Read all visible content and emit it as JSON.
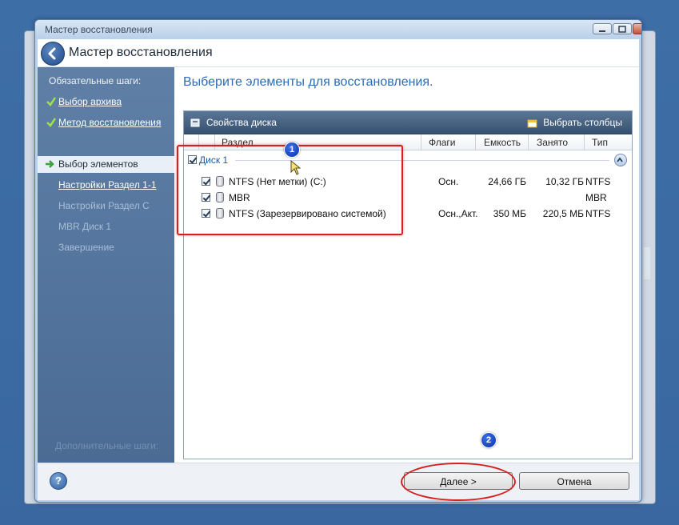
{
  "window": {
    "title": "Мастер восстановления",
    "header_title": "Мастер восстановления"
  },
  "sidebar": {
    "header": "Обязательные шаги:",
    "items": [
      {
        "label": "Выбор архива",
        "state": "done"
      },
      {
        "label": "Метод восстановления",
        "state": "done"
      },
      {
        "label": "Выбор элементов",
        "state": "current"
      },
      {
        "label": "Настройки Раздел 1-1",
        "state": "link"
      },
      {
        "label": "Настройки Раздел C",
        "state": "dim"
      },
      {
        "label": "MBR Диск 1",
        "state": "dim"
      },
      {
        "label": "Завершение",
        "state": "dim"
      }
    ],
    "footer": "Дополнительные шаги:"
  },
  "main": {
    "heading": "Выберите элементы для восстановления.",
    "toolbar": {
      "disk_props": "Свойства диска",
      "choose_columns": "Выбрать столбцы"
    },
    "columns": {
      "partition": "Раздел",
      "flags": "Флаги",
      "capacity": "Емкость",
      "used": "Занято",
      "type": "Тип"
    },
    "group": {
      "label": "Диск 1"
    },
    "rows": [
      {
        "name": "NTFS (Нет метки) (C:)",
        "flags": "Осн.",
        "capacity": "24,66 ГБ",
        "used": "10,32 ГБ",
        "type": "NTFS"
      },
      {
        "name": "MBR",
        "flags": "",
        "capacity": "",
        "used": "",
        "type": "MBR"
      },
      {
        "name": "NTFS (Зарезервировано системой)",
        "flags": "Осн.,Акт.",
        "capacity": "350 МБ",
        "used": "220,5 МБ",
        "type": "NTFS"
      }
    ]
  },
  "annotations": {
    "badge1": "1",
    "badge2": "2"
  },
  "footer": {
    "help": "?",
    "next": "Далее >",
    "cancel": "Отмена"
  },
  "colors": {
    "accent": "#2c6bb5",
    "annotation": "#d6201f",
    "sidebar": "#5a7aa2"
  }
}
